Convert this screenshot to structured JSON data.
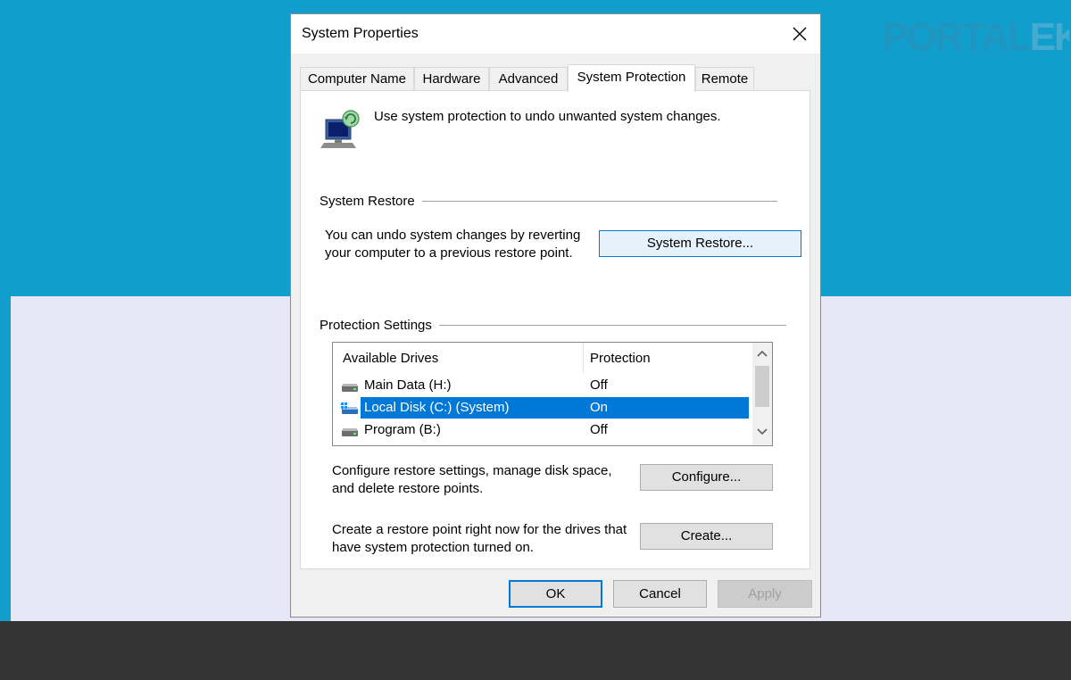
{
  "watermark": {
    "part1": "PORTAL",
    "part2": "EKONOMI"
  },
  "window": {
    "title": "System Properties"
  },
  "tabs": [
    {
      "label": "Computer Name",
      "active": false
    },
    {
      "label": "Hardware",
      "active": false
    },
    {
      "label": "Advanced",
      "active": false
    },
    {
      "label": "System Protection",
      "active": true
    },
    {
      "label": "Remote",
      "active": false
    }
  ],
  "intro_text": "Use system protection to undo unwanted system changes.",
  "system_restore": {
    "group_label": "System Restore",
    "description_line1": "You can undo system changes by reverting",
    "description_line2": "your computer to a previous restore point.",
    "button_label": "System Restore..."
  },
  "protection_settings": {
    "group_label": "Protection Settings",
    "columns": {
      "drives": "Available Drives",
      "protection": "Protection"
    },
    "drives": [
      {
        "name": "Main Data (H:)",
        "protection": "Off",
        "selected": false,
        "icon": "drive-icon"
      },
      {
        "name": "Local Disk (C:) (System)",
        "protection": "On",
        "selected": true,
        "icon": "system-drive-icon"
      },
      {
        "name": "Program (B:)",
        "protection": "Off",
        "selected": false,
        "icon": "drive-icon"
      }
    ]
  },
  "configure": {
    "line1": "Configure restore settings, manage disk space,",
    "line2": "and delete restore points.",
    "button_label": "Configure..."
  },
  "create": {
    "line1": "Create a restore point right now for the drives that",
    "line2": "have system protection turned on.",
    "button_label": "Create..."
  },
  "footer": {
    "ok_label": "OK",
    "cancel_label": "Cancel",
    "apply_label": "Apply"
  },
  "colors": {
    "accent": "#0078d7",
    "background": "#129ecc",
    "selection": "#0078d7"
  }
}
